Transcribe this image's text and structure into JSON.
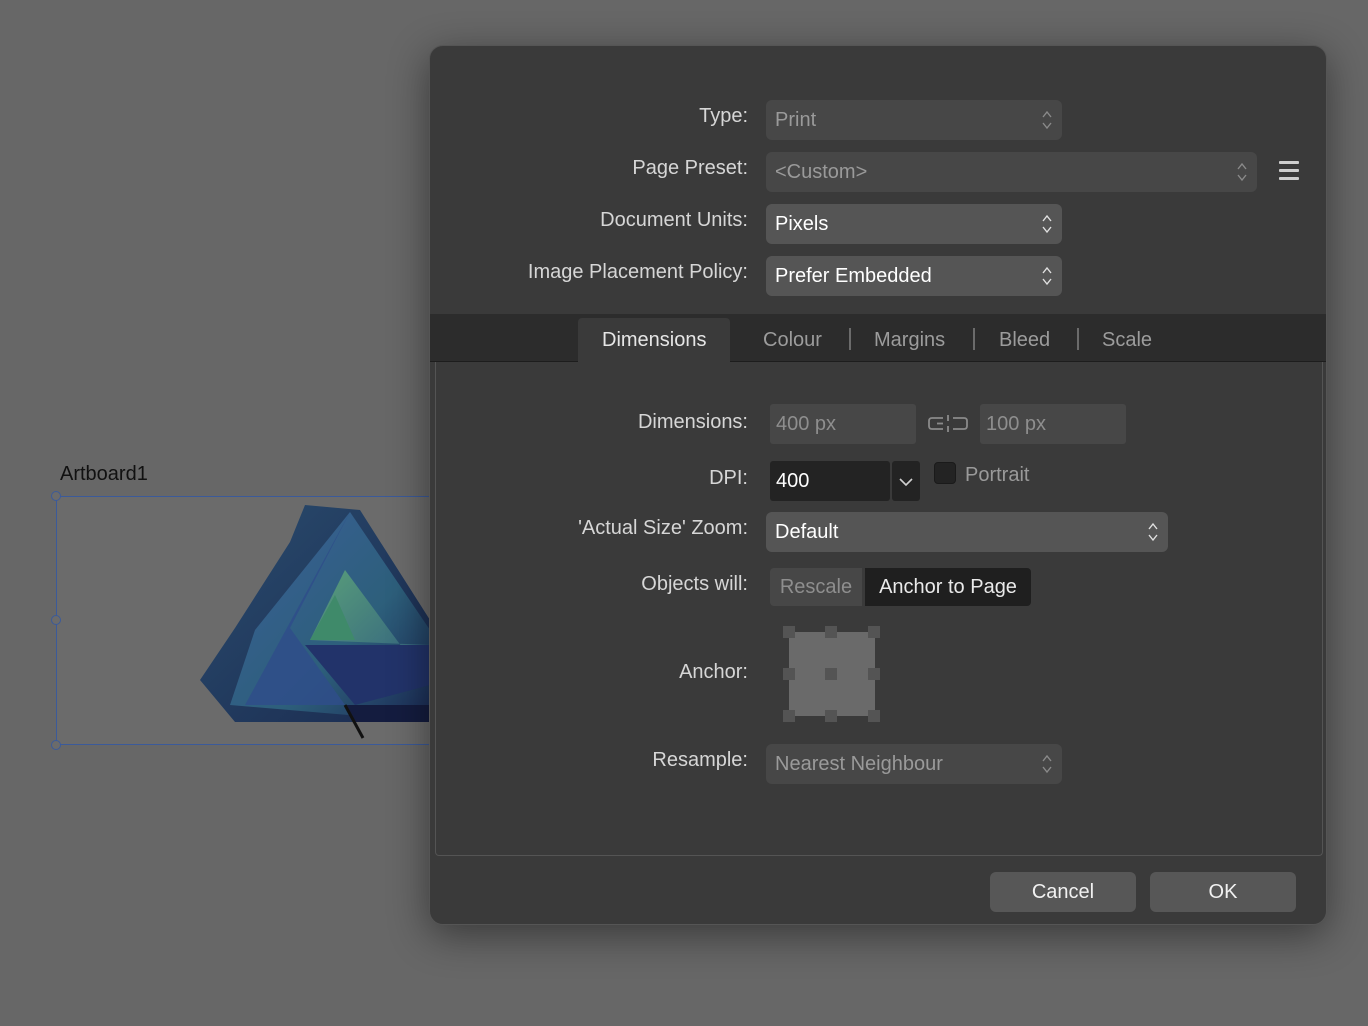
{
  "canvas": {
    "artboard_label": "Artboard1"
  },
  "dialog": {
    "fields": {
      "type": {
        "label": "Type:",
        "value": "Print"
      },
      "page_preset": {
        "label": "Page Preset:",
        "value": "<Custom>"
      },
      "document_units": {
        "label": "Document Units:",
        "value": "Pixels"
      },
      "image_placement": {
        "label": "Image Placement Policy:",
        "value": "Prefer Embedded"
      }
    },
    "tabs": [
      {
        "label": "Dimensions",
        "active": true
      },
      {
        "label": "Colour",
        "active": false
      },
      {
        "label": "Margins",
        "active": false
      },
      {
        "label": "Bleed",
        "active": false
      },
      {
        "label": "Scale",
        "active": false
      }
    ],
    "dimensions_tab": {
      "dimensions": {
        "label": "Dimensions:",
        "width": "400 px",
        "height": "100 px"
      },
      "dpi": {
        "label": "DPI:",
        "value": "400"
      },
      "portrait": {
        "label": "Portrait",
        "checked": false
      },
      "actual_size_zoom": {
        "label": "'Actual Size' Zoom:",
        "value": "Default"
      },
      "objects_will": {
        "label": "Objects will:",
        "options": [
          "Rescale",
          "Anchor to Page"
        ],
        "selected": "Anchor to Page"
      },
      "anchor": {
        "label": "Anchor:"
      },
      "resample": {
        "label": "Resample:",
        "value": "Nearest Neighbour"
      }
    },
    "buttons": {
      "cancel": "Cancel",
      "ok": "OK"
    }
  }
}
